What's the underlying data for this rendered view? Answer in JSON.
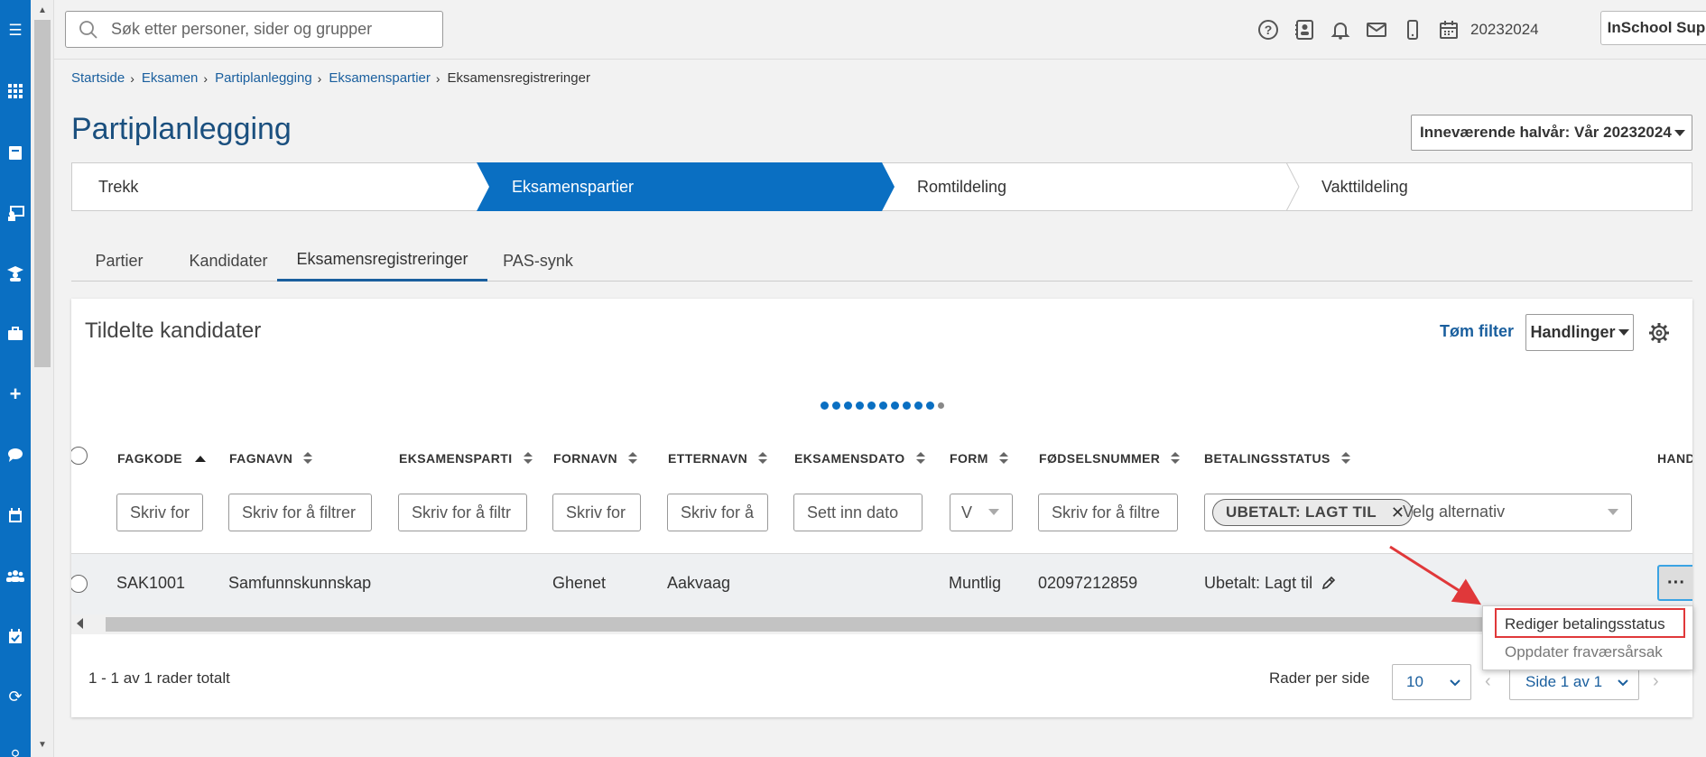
{
  "header": {
    "search_placeholder": "Søk etter personer, sider og grupper",
    "term": "20232024",
    "user_menu": "InSchool Support"
  },
  "breadcrumb": [
    "Startside",
    "Eksamen",
    "Partiplanlegging",
    "Eksamenspartier",
    "Eksamensregistreringer"
  ],
  "page": {
    "title": "Partiplanlegging",
    "term_select": "Inneværende halvår: Vår 20232024"
  },
  "steps": [
    "Trekk",
    "Eksamenspartier",
    "Romtildeling",
    "Vakttildeling"
  ],
  "tabs": [
    "Partier",
    "Kandidater",
    "Eksamensregistreringer",
    "PAS-synk"
  ],
  "card": {
    "title": "Tildelte kandidater",
    "clear_filter": "Tøm filter",
    "actions": "Handlinger",
    "columns": [
      "FAGKODE",
      "FAGNAVN",
      "EKSAMENSPARTI",
      "FORNAVN",
      "ETTERNAVN",
      "EKSAMENSDATO",
      "FORM",
      "FØDSELSNUMMER",
      "BETALINGSSTATUS",
      "HAND"
    ],
    "filters": {
      "fagkode": "Skriv for",
      "fagnavn": "Skriv for å filtrer",
      "eksamensparti": "Skriv for å filtr",
      "fornavn": "Skriv for",
      "etternavn": "Skriv for å",
      "eksamensdato": "Sett inn dato",
      "form": "V",
      "fodselsnummer": "Skriv for å filtre",
      "betalingsstatus_chip": "UBETALT: LAGT TIL",
      "betalingsstatus_placeholder": "Velg alternativ"
    },
    "row": {
      "fagkode": "SAK1001",
      "fagnavn": "Samfunnskunnskap",
      "eksamensparti": "",
      "fornavn": "Ghenet",
      "etternavn": "Aakvaag",
      "eksamensdato": "",
      "form": "Muntlig",
      "fodselsnummer": "02097212859",
      "betalingsstatus": "Ubetalt: Lagt til"
    },
    "footer": {
      "count": "1 - 1 av 1 rader totalt",
      "rows_per_page_label": "Rader per side",
      "rows_per_page": "10",
      "page": "Side 1 av 1"
    }
  },
  "context_menu": [
    "Rediger betalingsstatus",
    "Oppdater fraværsårsak"
  ],
  "colors": {
    "brand": "#0a6fc2",
    "link": "#1a5f9e",
    "highlight_box": "#e0383a"
  }
}
